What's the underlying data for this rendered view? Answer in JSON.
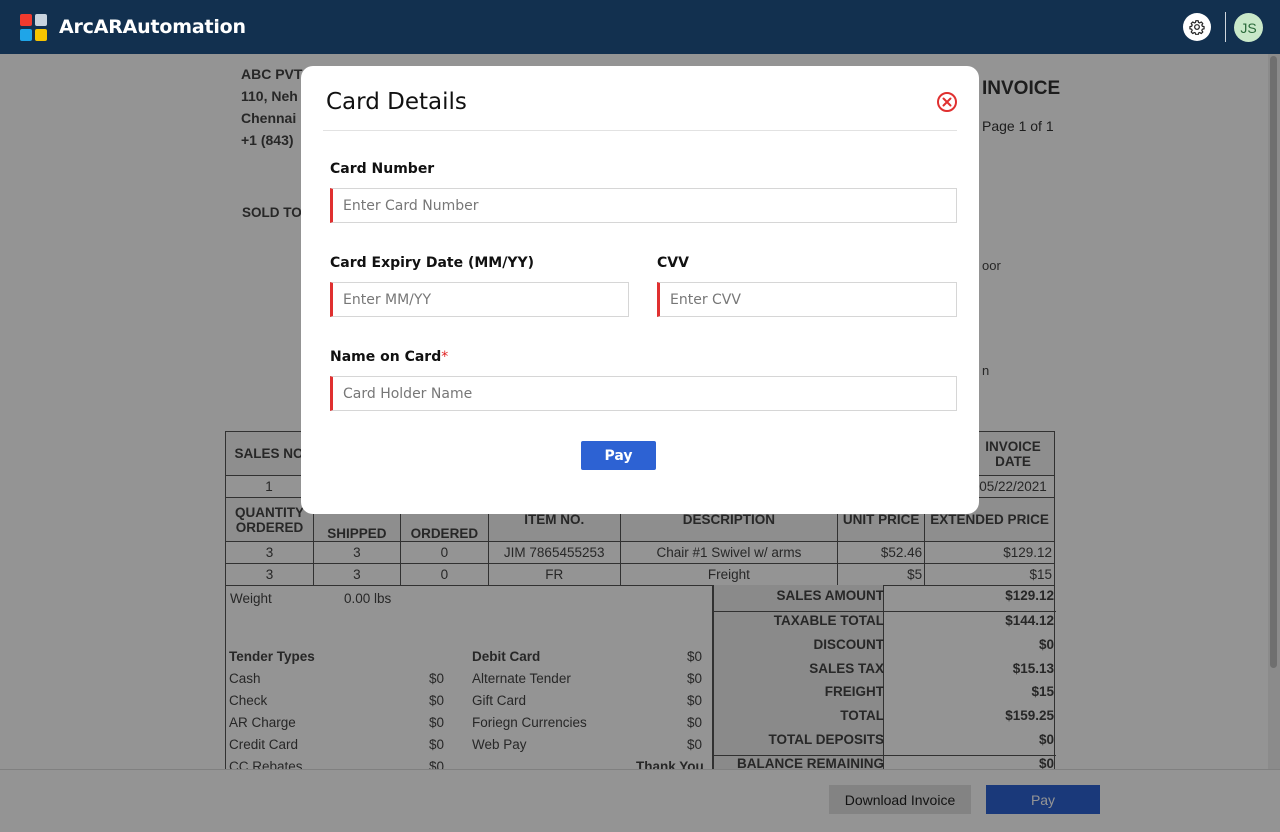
{
  "app": {
    "title": "ArcARAutomation",
    "user_initials": "JS"
  },
  "invoice": {
    "company": [
      "ABC PVT",
      "110, Neh",
      "Chennai",
      "+1 (843)"
    ],
    "title": "INVOICE",
    "page": "Page 1 of 1",
    "sold_to": "SOLD TO",
    "side_fragments": [
      "oor",
      "n"
    ],
    "top_table": {
      "headers": [
        "SALES NO",
        "INVOICE DATE"
      ],
      "values": [
        "1",
        "05/22/2021"
      ]
    },
    "items_table": {
      "headers": [
        "QUANTITY ORDERED",
        "SHIPPED",
        "ORDERED",
        "ITEM NO.",
        "DESCRIPTION",
        "UNIT PRICE",
        "EXTENDED PRICE"
      ],
      "rows": [
        [
          "3",
          "3",
          "0",
          "JIM 7865455253",
          "Chair #1 Swivel w/ arms",
          "$52.46",
          "$129.12"
        ],
        [
          "3",
          "3",
          "0",
          "FR",
          "Freight",
          "$5",
          "$15"
        ]
      ]
    },
    "weight": {
      "label": "Weight",
      "value": "0.00 lbs"
    },
    "tender_left": {
      "title": "Tender Types",
      "items": [
        {
          "label": "Cash",
          "value": "$0"
        },
        {
          "label": "Check",
          "value": "$0"
        },
        {
          "label": "AR Charge",
          "value": "$0"
        },
        {
          "label": "Credit Card",
          "value": "$0"
        },
        {
          "label": "CC Rebates",
          "value": "$0"
        }
      ]
    },
    "tender_right": {
      "title": "Debit Card",
      "title_value": "$0",
      "items": [
        {
          "label": "Alternate Tender",
          "value": "$0"
        },
        {
          "label": "Gift Card",
          "value": "$0"
        },
        {
          "label": "Foriegn Currencies",
          "value": "$0"
        },
        {
          "label": "Web Pay",
          "value": "$0"
        }
      ],
      "thank_you": "Thank You"
    },
    "summary": [
      {
        "label": "SALES AMOUNT",
        "value": "$129.12"
      },
      {
        "label": "TAXABLE TOTAL",
        "value": "$144.12"
      },
      {
        "label": "DISCOUNT",
        "value": "$0"
      },
      {
        "label": "SALES TAX",
        "value": "$15.13"
      },
      {
        "label": "FREIGHT",
        "value": "$15"
      },
      {
        "label": "TOTAL",
        "value": "$159.25"
      },
      {
        "label": "TOTAL DEPOSITS",
        "value": "$0"
      },
      {
        "label": "BALANCE REMAINING",
        "value": "$0"
      }
    ]
  },
  "bottom": {
    "download_label": "Download  Invoice",
    "pay_label": "Pay"
  },
  "modal": {
    "title": "Card Details",
    "card_number": {
      "label": "Card Number",
      "placeholder": "Enter Card Number",
      "value": ""
    },
    "expiry": {
      "label": "Card Expiry Date (MM/YY)",
      "placeholder": "Enter MM/YY",
      "value": ""
    },
    "cvv": {
      "label": "CVV",
      "placeholder": "Enter CVV",
      "value": ""
    },
    "name": {
      "label": "Name on Card",
      "required_mark": "*",
      "placeholder": "Card Holder Name",
      "value": ""
    },
    "pay_label": "Pay"
  },
  "colors": {
    "topbar": "#12304f",
    "primary_button": "#2d62d3",
    "input_error_accent": "#e03030",
    "close_icon": "#e03030"
  },
  "icons": [
    "arcar-logo-icon",
    "gear-icon",
    "close-circle-icon"
  ]
}
